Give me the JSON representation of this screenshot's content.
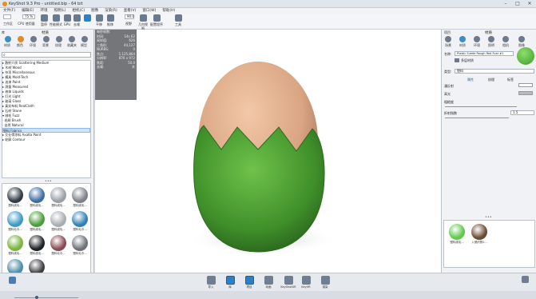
{
  "window": {
    "title": "KeyShot 9.3 Pro - untitled.bip - 64 bit",
    "controls": [
      "–",
      "□",
      "✕"
    ]
  },
  "menu": [
    "文件(F)",
    "编辑(E)",
    "环境",
    "照明(L)",
    "相机(C)",
    "图像",
    "渲染(R)",
    "查看(V)",
    "窗口(W)",
    "帮助(H)"
  ],
  "toolbar": {
    "cpu_value": "75 %",
    "render_value": "90.0",
    "items": [
      "工作区",
      "CPU 使用量",
      "暂停",
      "性能模式",
      "GPU",
      "去噪",
      "平移",
      "推移",
      "视野",
      "几何视图",
      "配置程序",
      "工具"
    ]
  },
  "library": {
    "title": "库",
    "panel_title": "材质",
    "tabs": [
      "材质",
      "颜色",
      "环境",
      "背景",
      "纹理",
      "收藏夹",
      "模型"
    ],
    "search_placeholder": "",
    "tree": [
      "▸ 散射介质 Scattering Medium",
      "▸ 木材 Wood",
      "▸ 杂项 Miscellaneous",
      "▸ 模具 Mold-Tech",
      "▸ 油漆 Paint",
      "▸ 测量 Measured",
      "▸ 液体 Liquids",
      "▸ 灯光 Light",
      "▸ 玻璃 Glass",
      "▸ 真实布料 RealCloth",
      "▸ 石材 Stone",
      "▾ 绒毛 Fuzz",
      "  · 毛刷 Brush",
      "  · 自然 Natural",
      "  塑料 Fabrics",
      "▸ 艾仕得涂料 Axalta Paint",
      "▸ 轮廓 Contour"
    ],
    "selected_index": 14,
    "thumbs": [
      {
        "label": "塑料绒毛...",
        "color": "#2f3b47"
      },
      {
        "label": "塑料绒毛...",
        "color": "#3d6fa3"
      },
      {
        "label": "塑料绒毛...",
        "color": "#9aa0a6"
      },
      {
        "label": "塑料绒毛...",
        "color": "#7c8288"
      },
      {
        "label": "塑料毛巾...",
        "color": "#3b9ac6"
      },
      {
        "label": "塑料绒毛...",
        "color": "#4a9e3a"
      },
      {
        "label": "塑料绒毛...",
        "color": "#a9adb1"
      },
      {
        "label": "塑料毛巾...",
        "color": "#2f7fb8"
      },
      {
        "label": "塑料绒毛...",
        "color": "#79b43c"
      },
      {
        "label": "塑料绒毛...",
        "color": "#1e2226"
      },
      {
        "label": "塑料毛巾...",
        "color": "#8a4a54"
      },
      {
        "label": "塑料毛巾...",
        "color": "#6e7278"
      },
      {
        "label": "塑料绒毛...",
        "color": "#4d8ca6"
      },
      {
        "label": "塑料毛巾...",
        "color": "#3d3f43"
      }
    ]
  },
  "hud": {
    "rows": [
      [
        "每秒帧数:",
        ""
      ],
      [
        "时间:",
        "14s 62"
      ],
      [
        "采样值:",
        "626"
      ],
      [
        "三角形:",
        "44,127"
      ],
      [
        "NURBS:",
        "0"
      ],
      [
        "焦点:",
        "1,125,864"
      ],
      [
        "分辨率:",
        "870 x 972"
      ],
      [
        "焦距:",
        "50.0"
      ],
      [
        "去噪:",
        "关"
      ]
    ]
  },
  "project": {
    "title": "项目",
    "panel_title": "材质",
    "tabs": [
      "场景",
      "材质",
      "环境",
      "照明",
      "相机",
      "图像"
    ],
    "name_label": "名称:",
    "name_value": "Plastic Suede Rough Red Fuzz #1",
    "type_label": "类型:",
    "type_value": "塑料",
    "add_label": "多层材质",
    "subtabs": [
      "属性",
      "纹理",
      "标签"
    ],
    "props": [
      {
        "label": "漫反射"
      },
      {
        "label": "高光"
      },
      {
        "label": "粗糙度"
      },
      {
        "label": "折射指数",
        "value": "1.5"
      }
    ],
    "mat_thumbs": [
      {
        "label": "塑料绒毛...",
        "color": "#5fc948"
      },
      {
        "label": "入侵织物2...",
        "color": "#6b4a32"
      }
    ]
  },
  "bottombar": [
    "导入",
    "库",
    "项目",
    "动画",
    "KeyShotXR",
    "KeyVR",
    "渲染"
  ]
}
